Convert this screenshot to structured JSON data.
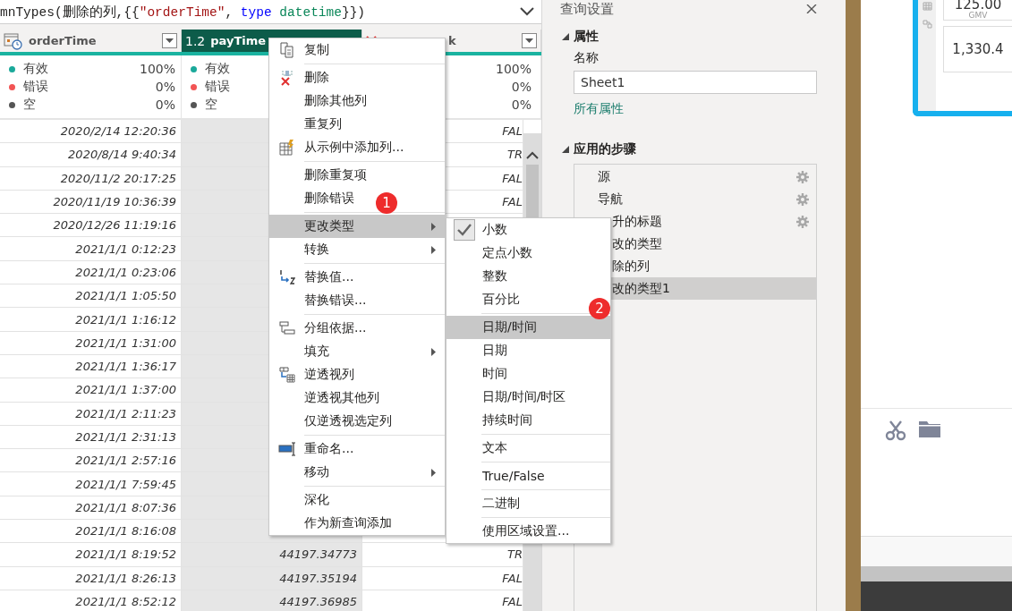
{
  "formula_bar": {
    "tokens": [
      {
        "kind": "plain",
        "text": "mnTypes(删除的列,{{"
      },
      {
        "kind": "string",
        "text": "\"orderTime\""
      },
      {
        "kind": "plain",
        "text": ", "
      },
      {
        "kind": "keyword",
        "text": "type"
      },
      {
        "kind": "type",
        "text": "datetime"
      },
      {
        "kind": "plain",
        "text": "}})"
      }
    ]
  },
  "table": {
    "columns": [
      {
        "kind": "datetime",
        "title": "orderTime",
        "selected": false,
        "dropdown": true,
        "quality": [
          {
            "label": "有效",
            "value": "100%",
            "color": "#1aa99a"
          },
          {
            "label": "错误",
            "value": "0%",
            "color": "#f25454"
          },
          {
            "label": "空",
            "value": "0%",
            "color": "#555555"
          }
        ]
      },
      {
        "kind": "number",
        "type_label": "1.2",
        "title": "payTime",
        "selected": true,
        "dropdown": false,
        "quality": [
          {
            "label": "有效",
            "color": "#1aa99a"
          },
          {
            "label": "错误",
            "color": "#f25454"
          },
          {
            "label": "空",
            "color": "#555555"
          }
        ]
      },
      {
        "kind": "error",
        "title": "k",
        "selected": false,
        "dropdown": true,
        "quality": [
          {
            "value": "100%"
          },
          {
            "value": "0%"
          },
          {
            "value": "0%"
          }
        ]
      }
    ],
    "rows": [
      {
        "order_time": "2020/2/14 12:20:36",
        "column_3": "FAL"
      },
      {
        "order_time": "2020/8/14 9:40:34",
        "column_3": "TR"
      },
      {
        "order_time": "2020/11/2 20:17:25",
        "column_3": "FAL"
      },
      {
        "order_time": "2020/11/19 10:36:39",
        "column_3": "FAL"
      },
      {
        "order_time": "2020/12/26 11:19:16"
      },
      {
        "order_time": "2021/1/1 0:12:23"
      },
      {
        "order_time": "2021/1/1 0:23:06"
      },
      {
        "order_time": "2021/1/1 1:05:50"
      },
      {
        "order_time": "2021/1/1 1:16:12"
      },
      {
        "order_time": "2021/1/1 1:31:00"
      },
      {
        "order_time": "2021/1/1 1:36:17"
      },
      {
        "order_time": "2021/1/1 1:37:00"
      },
      {
        "order_time": "2021/1/1 2:11:23"
      },
      {
        "order_time": "2021/1/1 2:31:13"
      },
      {
        "order_time": "2021/1/1 2:57:16"
      },
      {
        "order_time": "2021/1/1 7:59:45"
      },
      {
        "order_time": "2021/1/1 8:07:36"
      },
      {
        "order_time": "2021/1/1 8:16:08"
      },
      {
        "order_time": "2021/1/1 8:19:52",
        "pay_time": "44197.34773",
        "column_3": "TR"
      },
      {
        "order_time": "2021/1/1 8:26:13",
        "pay_time": "44197.35194",
        "column_3": "FAL"
      },
      {
        "order_time": "2021/1/1 8:52:12",
        "pay_time": "44197.36985",
        "column_3": "FAL"
      }
    ]
  },
  "context_menu": {
    "items": [
      {
        "kind": "item",
        "label": "复制",
        "has_submenu": false,
        "highlighted": false
      },
      {
        "kind": "separator"
      },
      {
        "kind": "item",
        "label": "删除",
        "has_submenu": false,
        "highlighted": false
      },
      {
        "kind": "item",
        "label": "删除其他列",
        "has_submenu": false,
        "highlighted": false
      },
      {
        "kind": "item",
        "label": "重复列",
        "has_submenu": false,
        "highlighted": false
      },
      {
        "kind": "item",
        "label": "从示例中添加列...",
        "has_submenu": false,
        "highlighted": false
      },
      {
        "kind": "separator"
      },
      {
        "kind": "item",
        "label": "删除重复项",
        "has_submenu": false,
        "highlighted": false
      },
      {
        "kind": "item",
        "label": "删除错误",
        "has_submenu": false,
        "highlighted": false
      },
      {
        "kind": "separator"
      },
      {
        "kind": "item",
        "label": "更改类型",
        "has_submenu": true,
        "highlighted": true
      },
      {
        "kind": "item",
        "label": "转换",
        "has_submenu": true,
        "highlighted": false
      },
      {
        "kind": "separator"
      },
      {
        "kind": "item",
        "label": "替换值...",
        "has_submenu": false,
        "highlighted": false
      },
      {
        "kind": "item",
        "label": "替换错误...",
        "has_submenu": false,
        "highlighted": false
      },
      {
        "kind": "separator"
      },
      {
        "kind": "item",
        "label": "分组依据...",
        "has_submenu": false,
        "highlighted": false
      },
      {
        "kind": "item",
        "label": "填充",
        "has_submenu": true,
        "highlighted": false
      },
      {
        "kind": "item",
        "label": "逆透视列",
        "has_submenu": false,
        "highlighted": false
      },
      {
        "kind": "item",
        "label": "逆透视其他列",
        "has_submenu": false,
        "highlighted": false
      },
      {
        "kind": "item",
        "label": "仅逆透视选定列",
        "has_submenu": false,
        "highlighted": false
      },
      {
        "kind": "separator"
      },
      {
        "kind": "item",
        "label": "重命名...",
        "has_submenu": false,
        "highlighted": false
      },
      {
        "kind": "item",
        "label": "移动",
        "has_submenu": true,
        "highlighted": false
      },
      {
        "kind": "separator"
      },
      {
        "kind": "item",
        "label": "深化",
        "has_submenu": false,
        "highlighted": false
      },
      {
        "kind": "item",
        "label": "作为新查询添加",
        "has_submenu": false,
        "highlighted": false
      }
    ]
  },
  "type_submenu": {
    "items": [
      {
        "kind": "item",
        "label": "小数",
        "checked": true,
        "highlighted": false
      },
      {
        "kind": "item",
        "label": "定点小数",
        "checked": false,
        "highlighted": false
      },
      {
        "kind": "item",
        "label": "整数",
        "checked": false,
        "highlighted": false
      },
      {
        "kind": "item",
        "label": "百分比",
        "checked": false,
        "highlighted": false
      },
      {
        "kind": "separator"
      },
      {
        "kind": "item",
        "label": "日期/时间",
        "checked": false,
        "highlighted": true
      },
      {
        "kind": "item",
        "label": "日期",
        "checked": false,
        "highlighted": false
      },
      {
        "kind": "item",
        "label": "时间",
        "checked": false,
        "highlighted": false
      },
      {
        "kind": "item",
        "label": "日期/时间/时区",
        "checked": false,
        "highlighted": false
      },
      {
        "kind": "item",
        "label": "持续时间",
        "checked": false,
        "highlighted": false
      },
      {
        "kind": "separator"
      },
      {
        "kind": "item",
        "label": "文本",
        "checked": false,
        "highlighted": false
      },
      {
        "kind": "separator"
      },
      {
        "kind": "item",
        "label": "True/False",
        "checked": false,
        "highlighted": false
      },
      {
        "kind": "separator"
      },
      {
        "kind": "item",
        "label": "二进制",
        "checked": false,
        "highlighted": false
      },
      {
        "kind": "separator"
      },
      {
        "kind": "item",
        "label": "使用区域设置...",
        "checked": false,
        "highlighted": false
      }
    ]
  },
  "markers": [
    {
      "text": "1"
    },
    {
      "text": "2"
    }
  ],
  "query_settings": {
    "title": "查询设置",
    "properties": {
      "heading": "属性",
      "expanded": true,
      "name_label": "名称",
      "name_value": "Sheet1",
      "link": "所有属性"
    },
    "applied_steps": {
      "heading": "应用的步骤",
      "expanded": true,
      "steps": [
        {
          "label": "源",
          "settings": true,
          "selected": false,
          "cut": false
        },
        {
          "label": "导航",
          "settings": true,
          "selected": false,
          "cut": false
        },
        {
          "label": "升的标题",
          "settings": true,
          "selected": false,
          "cut": true
        },
        {
          "label": "改的类型",
          "settings": false,
          "selected": false,
          "cut": true
        },
        {
          "label": "除的列",
          "settings": false,
          "selected": false,
          "cut": true
        },
        {
          "label": "改的类型1",
          "settings": false,
          "selected": true,
          "cut": true
        }
      ]
    }
  },
  "report_preview": {
    "cards": [
      {
        "value": "125.00",
        "caption": "GMV"
      },
      {
        "value": "1,330.4"
      }
    ]
  }
}
